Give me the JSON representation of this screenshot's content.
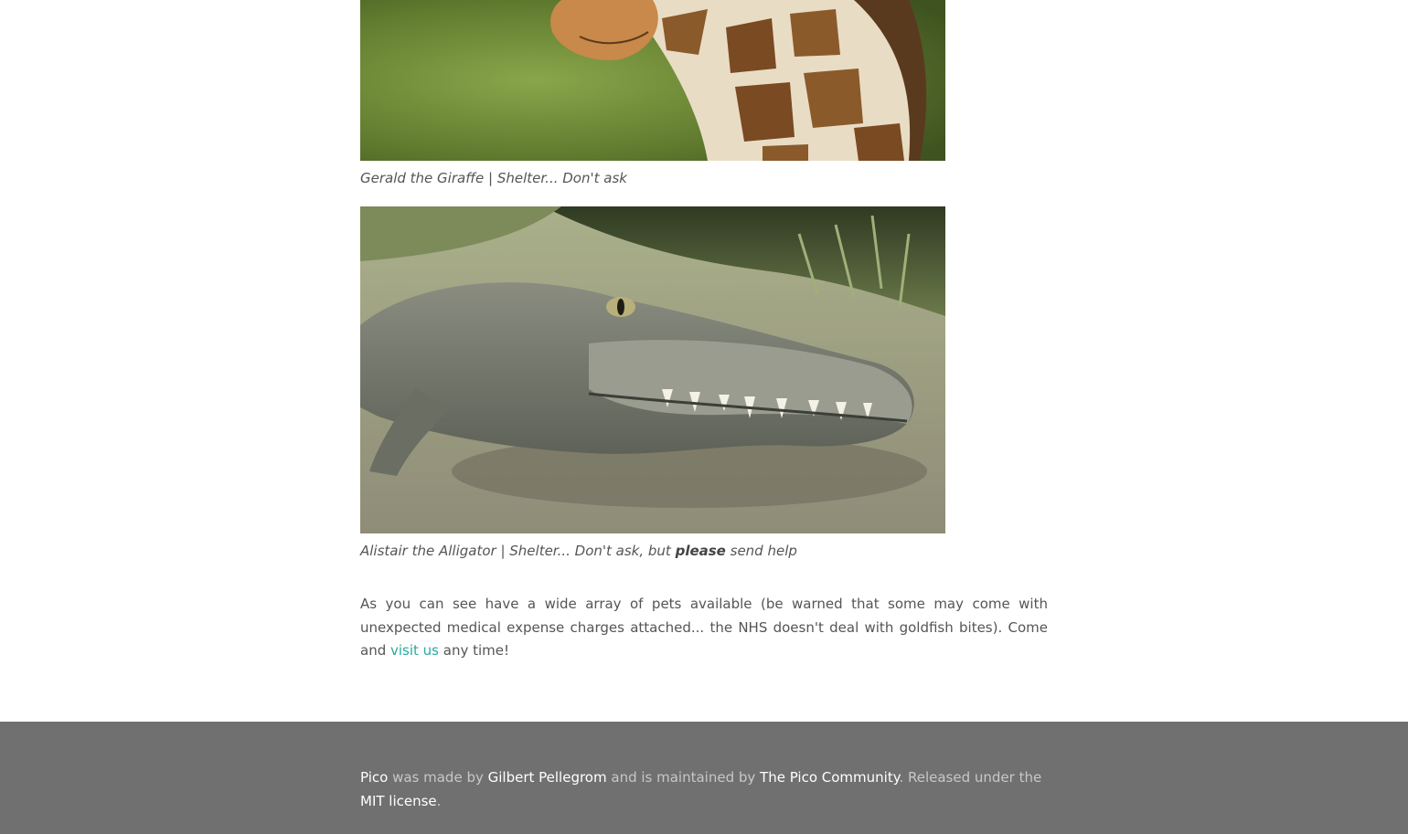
{
  "images": {
    "giraffe_alt": "Gerald the Giraffe",
    "alligator_alt": "Alistair the Alligator"
  },
  "captions": {
    "giraffe": "Gerald the Giraffe | Shelter... Don't ask",
    "alligator_prefix": "Alistair the Alligator | Shelter... Don't ask, but ",
    "alligator_emphasis": "please",
    "alligator_suffix": " send help"
  },
  "paragraph": {
    "text_before": "As you can see have a wide array of pets available (be warned that some may come with unexpected medical expense charges attached... the NHS doesn't deal with goldfish bites). Come and ",
    "link_text": "visit us",
    "text_after": " any time!"
  },
  "footer": {
    "pico_link": "Pico",
    "made_by": " was made by ",
    "author_link": "Gilbert Pellegrom",
    "maintained_by": " and is maintained by ",
    "community_link": "The Pico Community",
    "released_under": ". Released under the ",
    "license_link": "MIT license",
    "end": "."
  },
  "colors": {
    "link": "#2aa9a0",
    "footer_bg": "#707070",
    "footer_text": "#c7c7c7",
    "footer_link": "#ffffff"
  }
}
